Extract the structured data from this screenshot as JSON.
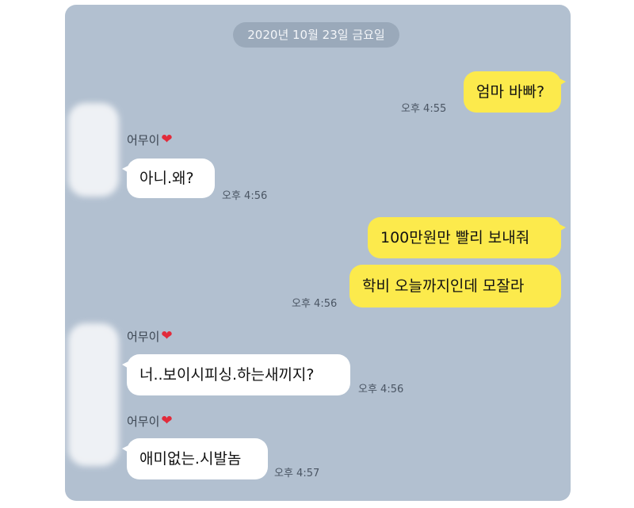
{
  "date_header": "2020년 10월 23일 금요일",
  "messages": [
    {
      "from": "me",
      "text": "엄마 바빠?",
      "time": "오후 4:55"
    },
    {
      "from": "them",
      "sender": "어무이",
      "text": "아니.왜?",
      "time": "오후 4:56"
    },
    {
      "from": "me",
      "text": "100만원만 빨리 보내줘"
    },
    {
      "from": "me",
      "text": "학비 오늘까지인데 모잘라",
      "time": "오후 4:56"
    },
    {
      "from": "them",
      "sender": "어무이",
      "text": "너..보이시피싱.하는새끼지?",
      "time": "오후 4:56"
    },
    {
      "from": "them",
      "sender": "어무이",
      "text": "애미없는.시발놈",
      "time": "오후 4:57"
    }
  ],
  "icons": {
    "sender_heart": "heart-icon",
    "avatar": "blurred-avatar"
  },
  "colors": {
    "background": "#b2c0d0",
    "my_bubble": "#fcea4c",
    "their_bubble": "#ffffff",
    "heart": "#e22b3b"
  }
}
